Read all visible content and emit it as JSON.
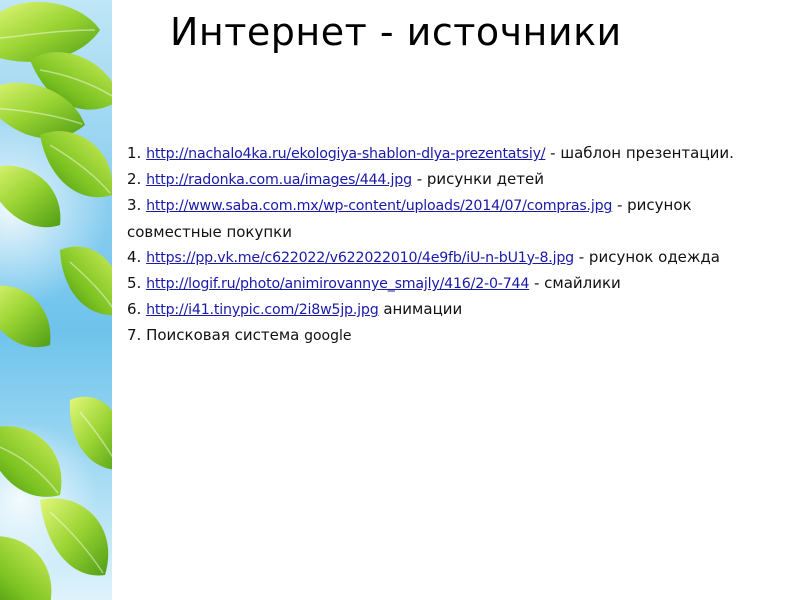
{
  "slide": {
    "title": "Интернет - источники",
    "items": [
      {
        "number": "1.",
        "url": "http://nachalo4ka.ru/ekologiya-shablon-dlya-prezentatsiy/",
        "description": "- шаблон презентации."
      },
      {
        "number": "2.",
        "url": "http://radonka.com.ua/images/444.jpg",
        "description": "- рисунки детей"
      },
      {
        "number": "3.",
        "url": "http://www.saba.com.mx/wp-content/uploads/2014/07/compras.jpg",
        "description": "- рисунок совместные покупки"
      },
      {
        "number": "4.",
        "url": "https://pp.vk.me/c622022/v622022010/4e9fb/iU-n-bU1y-8.jpg",
        "description": "- рисунок одежда"
      },
      {
        "number": "5.",
        "url": "http://logif.ru/photo/animirovannye_smajly/416/2-0-744",
        "description": "- смайлики"
      },
      {
        "number": "6.",
        "url": "http://i41.tinypic.com/2i8w5jp.jpg",
        "description": "анимации"
      },
      {
        "number": "7.",
        "text": "Поисковая система",
        "engine": "google"
      }
    ]
  },
  "colors": {
    "link": "#1a1aa8",
    "text": "#111111",
    "leaf_light": "#c8ec4a",
    "leaf_dark": "#5fae1c",
    "sky": "#6ec3ec"
  }
}
